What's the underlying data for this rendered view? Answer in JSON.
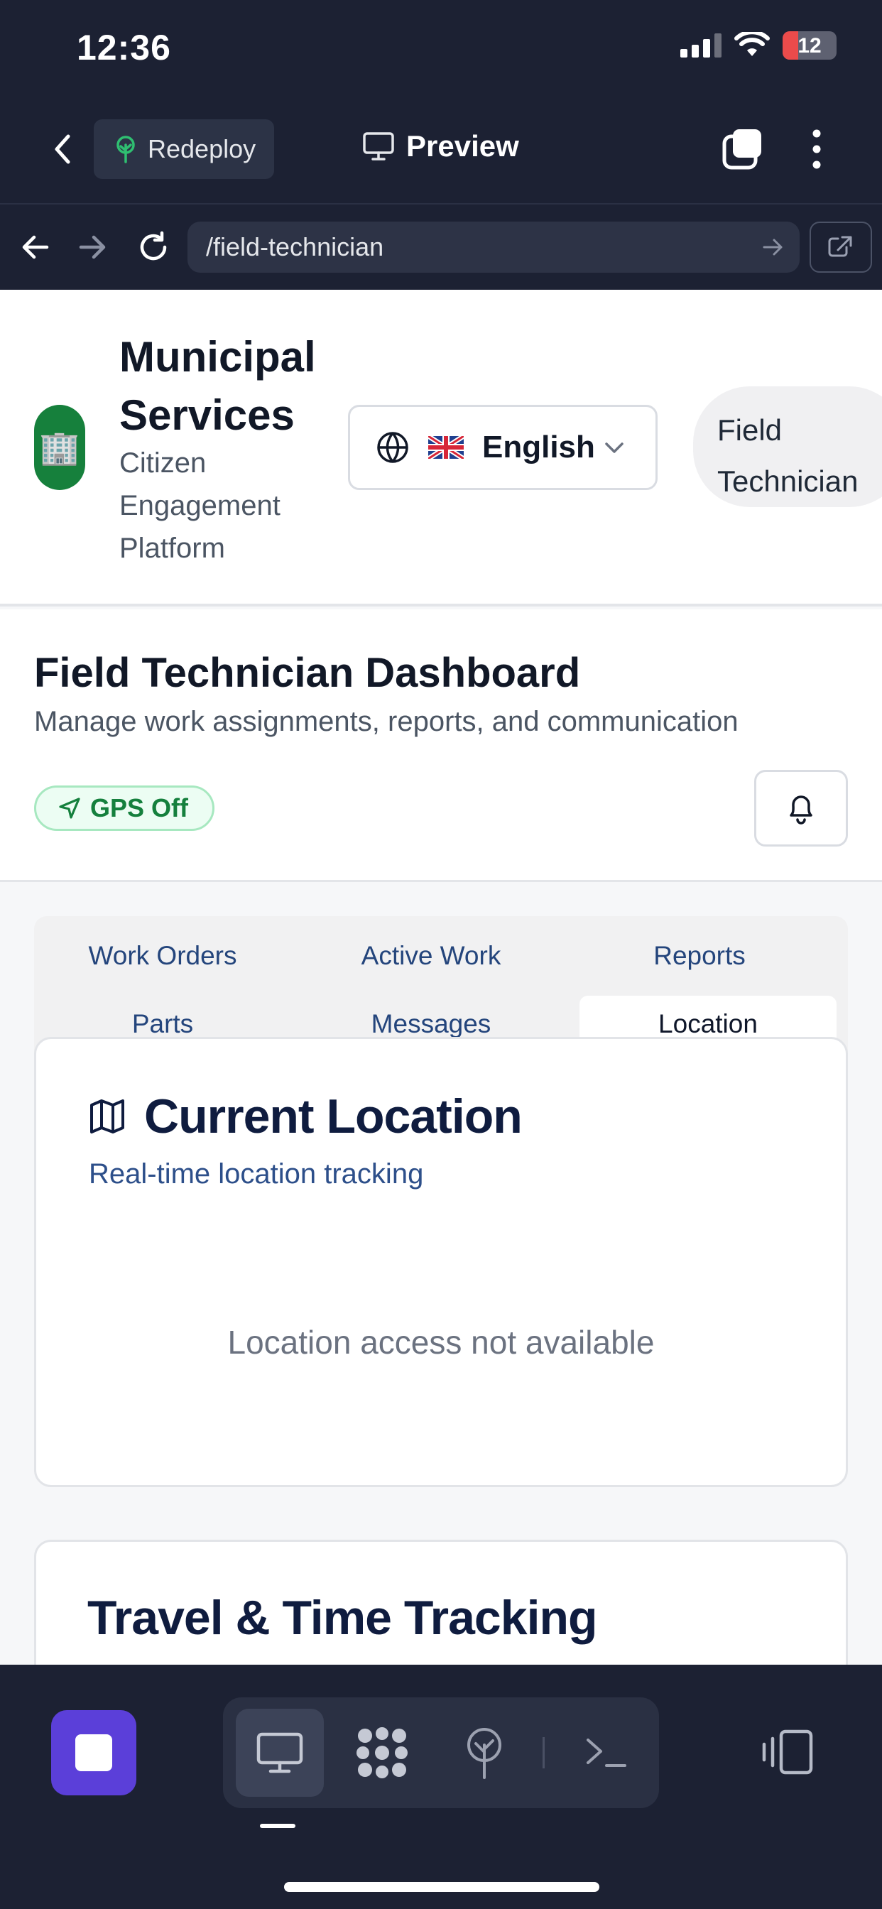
{
  "status_bar": {
    "time": "12:36",
    "battery_level": "12"
  },
  "app_bar": {
    "redeploy_label": "Redeploy",
    "preview_label": "Preview"
  },
  "browser": {
    "url": "/field-technician"
  },
  "site_header": {
    "org_name": "Municipal Services",
    "org_subtitle": "Citizen Engagement Platform",
    "language": "English",
    "role": "Field Technician"
  },
  "dashboard": {
    "title": "Field Technician Dashboard",
    "subtitle": "Manage work assignments, reports, and communication",
    "gps_status": "GPS Off"
  },
  "tabs": [
    {
      "label": "Work Orders",
      "active": false
    },
    {
      "label": "Active Work",
      "active": false
    },
    {
      "label": "Reports",
      "active": false
    },
    {
      "label": "Parts",
      "active": false
    },
    {
      "label": "Messages",
      "active": false
    },
    {
      "label": "Location",
      "active": true
    }
  ],
  "location_card": {
    "title": "Current Location",
    "description": "Real-time location tracking",
    "empty_message": "Location access not available"
  },
  "travel_card": {
    "title": "Travel & Time Tracking"
  },
  "colors": {
    "chrome_bg": "#1c2133",
    "accent_purple": "#5b3fd9",
    "logo_green": "#16803c",
    "gps_green": "#15803d",
    "heading_navy": "#0f1c3f"
  },
  "icons": {
    "app_bar": [
      "back-chevron-icon",
      "tree-icon",
      "monitor-icon",
      "tabs-icon",
      "more-vertical-icon"
    ],
    "browser": [
      "arrow-left-icon",
      "arrow-right-icon",
      "reload-icon",
      "go-arrow-icon",
      "external-link-icon"
    ],
    "header": [
      "building-icon",
      "globe-icon",
      "uk-flag-icon",
      "chevron-down-icon"
    ],
    "dashboard": [
      "navigation-icon",
      "bell-icon",
      "map-icon"
    ],
    "toolbar": [
      "stop-icon",
      "desktop-icon",
      "apps-icon",
      "deploy-icon",
      "terminal-icon",
      "split-layout-icon"
    ]
  }
}
